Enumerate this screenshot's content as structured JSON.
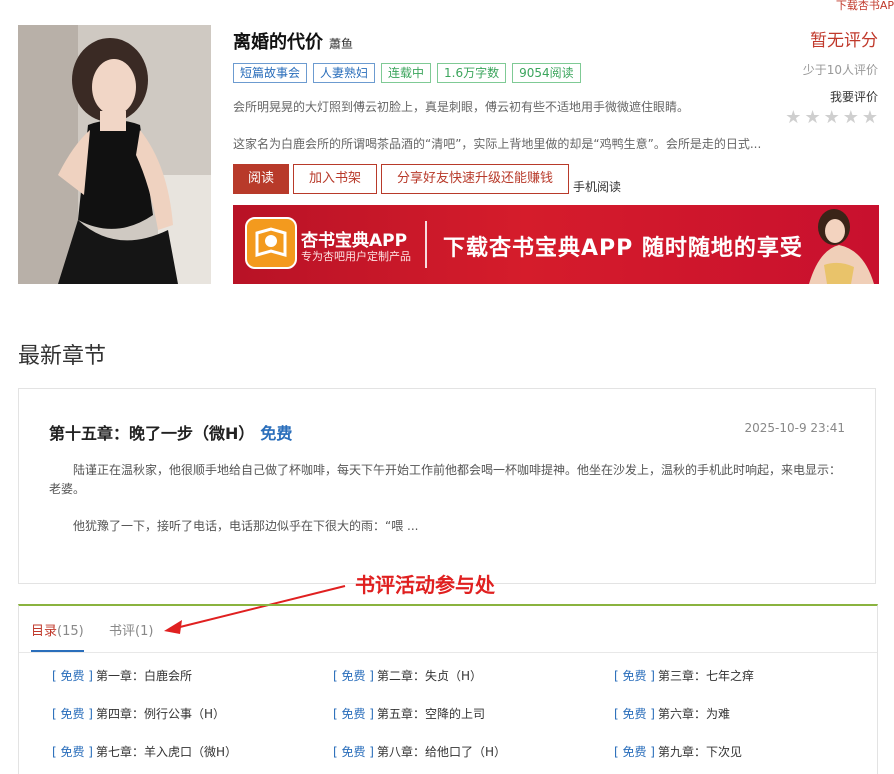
{
  "header": {
    "download_link": "下载杏书AP"
  },
  "book": {
    "title": "离婚的代价",
    "author": "蕭鱼",
    "tags": [
      {
        "label": "短篇故事会",
        "color": "blue"
      },
      {
        "label": "人妻熟妇",
        "color": "blue"
      },
      {
        "label": "连载中",
        "color": "green"
      },
      {
        "label": "1.6万字数",
        "color": "green"
      },
      {
        "label": "9054阅读",
        "color": "green"
      }
    ],
    "desc1": "会所明晃晃的大灯照到傅云初脸上，真是刺眼，傅云初有些不适地用手微微遮住眼睛。",
    "desc2": "这家名为白鹿会所的所谓喝茶品酒的“清吧”，实际上背地里做的却是“鸡鸭生意”。会所是走的日式...",
    "buttons": {
      "read": "阅读",
      "add_shelf": "加入书架",
      "share": "分享好友快速升级还能赚钱",
      "mobile": "手机阅读"
    }
  },
  "rating": {
    "score": "暂无评分",
    "count": "少于10人评价",
    "rate_link": "我要评价",
    "stars": 5
  },
  "banner": {
    "app_name": "杏书宝典APP",
    "app_sub": "专为杏吧用户定制产品",
    "slogan": "下载杏书宝典APP 随时随地的享受"
  },
  "latest": {
    "section_title": "最新章节",
    "chapter": "第十五章：晚了一步（微H）",
    "free": "免费",
    "time": "2025-10-9 23:41",
    "p1": "陆谨正在温秋家，他很顺手地给自己做了杯咖啡，每天下午开始工作前他都会喝一杯咖啡提神。他坐在沙发上，温秋的手机此时响起，来电显示：老婆。",
    "p2": "他犹豫了一下，接听了电话，电话那边似乎在下很大的雨：“喂 ..."
  },
  "annotation": "书评活动参与处",
  "tabs": [
    {
      "label": "目录",
      "count": "(15)"
    },
    {
      "label": "书评",
      "count": "(1)"
    }
  ],
  "chapters": [
    {
      "free": "[ 免费 ]",
      "title": "第一章：白鹿会所"
    },
    {
      "free": "[ 免费 ]",
      "title": "第二章：失贞（H）"
    },
    {
      "free": "[ 免费 ]",
      "title": "第三章：七年之痒"
    },
    {
      "free": "[ 免费 ]",
      "title": "第四章：例行公事（H）"
    },
    {
      "free": "[ 免费 ]",
      "title": "第五章：空降的上司"
    },
    {
      "free": "[ 免费 ]",
      "title": "第六章：为难"
    },
    {
      "free": "[ 免费 ]",
      "title": "第七章：羊入虎口（微H）"
    },
    {
      "free": "[ 免费 ]",
      "title": "第八章：给他口了（H）"
    },
    {
      "free": "[ 免费 ]",
      "title": "第九章：下次见"
    }
  ],
  "colors": {
    "accent_red": "#c0392b",
    "link_blue": "#2a6ebb",
    "tab_green": "#8ab33f"
  }
}
